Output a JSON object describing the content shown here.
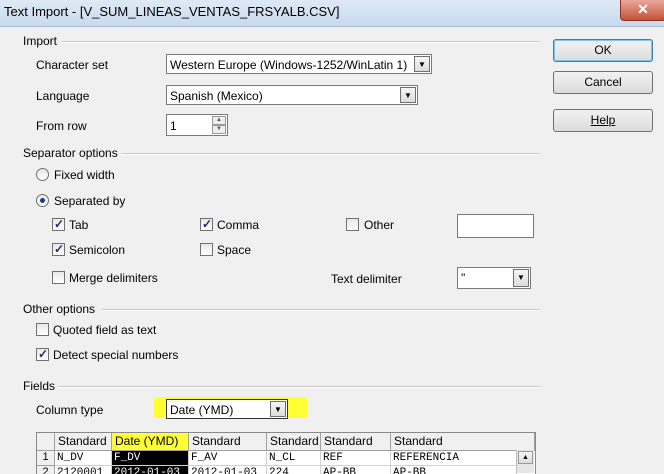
{
  "window": {
    "title": "Text Import - [V_SUM_LINEAS_VENTAS_FRSYALB.CSV]",
    "close_symbol": "✕"
  },
  "buttons": {
    "ok": "OK",
    "cancel": "Cancel",
    "help": "Help"
  },
  "import": {
    "section_title": "Import",
    "charset_label": "Character set",
    "charset_value": "Western Europe (Windows-1252/WinLatin 1)",
    "language_label": "Language",
    "language_value": "Spanish (Mexico)",
    "from_row_label": "From row",
    "from_row_value": "1"
  },
  "separator": {
    "section_title": "Separator options",
    "fixed_width": "Fixed width",
    "separated_by": "Separated by",
    "tab": "Tab",
    "comma": "Comma",
    "other": "Other",
    "semicolon": "Semicolon",
    "space": "Space",
    "merge_delimiters": "Merge delimiters",
    "text_delimiter_label": "Text delimiter",
    "text_delimiter_value": "\"",
    "other_value": ""
  },
  "other_options": {
    "section_title": "Other options",
    "quoted_field": "Quoted field as text",
    "detect_special": "Detect special numbers"
  },
  "fields": {
    "section_title": "Fields",
    "column_type_label": "Column type",
    "column_type_value": "Date (YMD)",
    "columns": [
      "Standard",
      "Date (YMD)",
      "Standard",
      "Standard",
      "Standard",
      "Standard"
    ],
    "rows": [
      {
        "num": "1",
        "cells": [
          "N_DV",
          "F_DV",
          "F_AV",
          "N_CL",
          "REF",
          "REFERENCIA"
        ]
      },
      {
        "num": "2",
        "cells": [
          "2120001",
          "2012-01-03",
          "2012-01-03",
          "224",
          "AP-BB",
          "AP-BB"
        ]
      }
    ]
  },
  "colors": {
    "highlight": "#ffff33"
  }
}
